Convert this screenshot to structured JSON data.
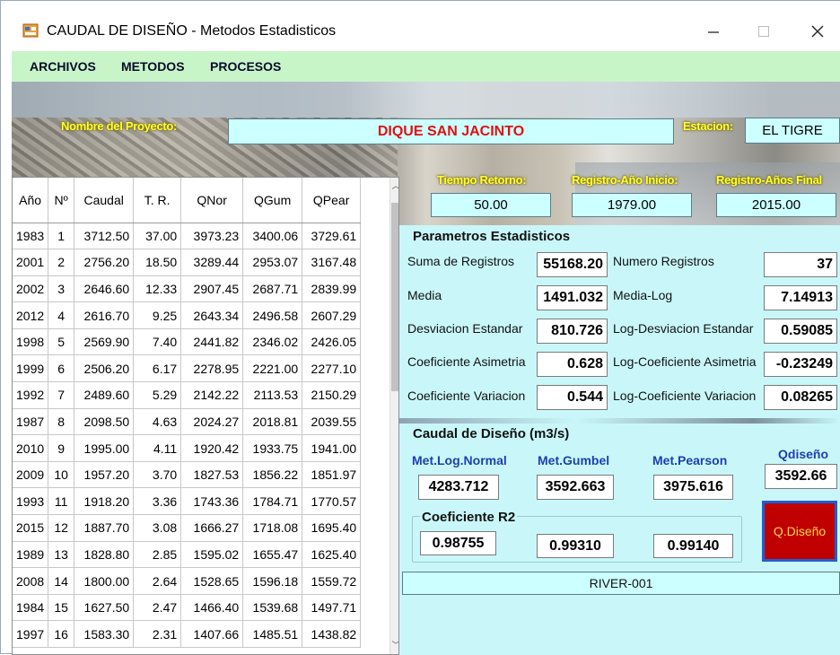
{
  "window": {
    "title": "CAUDAL DE DISEÑO - Metodos Estadisticos",
    "icon": "form-icon",
    "controls": {
      "minimize": "─",
      "maximize": "☐",
      "close": "✕"
    }
  },
  "menu": [
    "ARCHIVOS",
    "METODOS",
    "PROCESOS"
  ],
  "project": {
    "name_label": "Nombre del Proyecto:",
    "name_value": "DIQUE SAN JACINTO",
    "station_label": "Estacion:",
    "station_value": "EL TIGRE",
    "return_time_label": "Tiempo Retorno:",
    "return_time_value": "50.00",
    "start_year_label": "Registro-Año Inicio:",
    "start_year_value": "1979.00",
    "end_year_label": "Registro-Años Final",
    "end_year_value": "2015.00"
  },
  "table": {
    "headers": [
      "Año",
      "Nº",
      "Caudal",
      "T. R.",
      "QNor",
      "QGum",
      "QPear"
    ],
    "rows": [
      [
        "1983",
        "1",
        "3712.50",
        "37.00",
        "3973.23",
        "3400.06",
        "3729.61"
      ],
      [
        "2001",
        "2",
        "2756.20",
        "18.50",
        "3289.44",
        "2953.07",
        "3167.48"
      ],
      [
        "2002",
        "3",
        "2646.60",
        "12.33",
        "2907.45",
        "2687.71",
        "2839.99"
      ],
      [
        "2012",
        "4",
        "2616.70",
        "9.25",
        "2643.34",
        "2496.58",
        "2607.29"
      ],
      [
        "1998",
        "5",
        "2569.90",
        "7.40",
        "2441.82",
        "2346.02",
        "2426.05"
      ],
      [
        "1999",
        "6",
        "2506.20",
        "6.17",
        "2278.95",
        "2221.00",
        "2277.10"
      ],
      [
        "1992",
        "7",
        "2489.60",
        "5.29",
        "2142.22",
        "2113.53",
        "2150.29"
      ],
      [
        "1987",
        "8",
        "2098.50",
        "4.63",
        "2024.27",
        "2018.81",
        "2039.55"
      ],
      [
        "2010",
        "9",
        "1995.00",
        "4.11",
        "1920.42",
        "1933.75",
        "1941.00"
      ],
      [
        "2009",
        "10",
        "1957.20",
        "3.70",
        "1827.53",
        "1856.22",
        "1851.97"
      ],
      [
        "1993",
        "11",
        "1918.20",
        "3.36",
        "1743.36",
        "1784.71",
        "1770.57"
      ],
      [
        "2015",
        "12",
        "1887.70",
        "3.08",
        "1666.27",
        "1718.08",
        "1695.40"
      ],
      [
        "1989",
        "13",
        "1828.80",
        "2.85",
        "1595.02",
        "1655.47",
        "1625.40"
      ],
      [
        "2008",
        "14",
        "1800.00",
        "2.64",
        "1528.65",
        "1596.18",
        "1559.72"
      ],
      [
        "1984",
        "15",
        "1627.50",
        "2.47",
        "1466.40",
        "1539.68",
        "1497.71"
      ],
      [
        "1997",
        "16",
        "1583.30",
        "2.31",
        "1407.66",
        "1485.51",
        "1438.82"
      ]
    ]
  },
  "stats": {
    "title": "Parametros Estadisticos",
    "sum_label": "Suma de Registros",
    "sum_value": "55168.20",
    "count_label": "Numero Registros",
    "count_value": "37",
    "mean_label": "Media",
    "mean_value": "1491.032",
    "mean_log_label": "Media-Log",
    "mean_log_value": "7.14913",
    "std_label": "Desviacion Estandar",
    "std_value": "810.726",
    "std_log_label": "Log-Desviacion Estandar",
    "std_log_value": "0.59085",
    "skew_label": "Coeficiente Asimetria",
    "skew_value": "0.628",
    "skew_log_label": "Log-Coeficiente Asimetria",
    "skew_log_value": "-0.23249",
    "cv_label": "Coeficiente Variacion",
    "cv_value": "0.544",
    "cv_log_label": "Log-Coeficiente Variacion",
    "cv_log_value": "0.08265"
  },
  "design": {
    "title": "Caudal de Diseño (m3/s)",
    "lognormal_label": "Met.Log.Normal",
    "lognormal_value": "4283.712",
    "gumbel_label": "Met.Gumbel",
    "gumbel_value": "3592.663",
    "pearson_label": "Met.Pearson",
    "pearson_value": "3975.616",
    "qdesign_label": "Qdiseño",
    "qdesign_value": "3592.66",
    "r2_title": "Coeficiente R2",
    "r2_lognormal": "0.98755",
    "r2_gumbel": "0.99310",
    "r2_pearson": "0.99140",
    "button_label": "Q.Diseño"
  },
  "footer": {
    "code": "RIVER-001"
  }
}
